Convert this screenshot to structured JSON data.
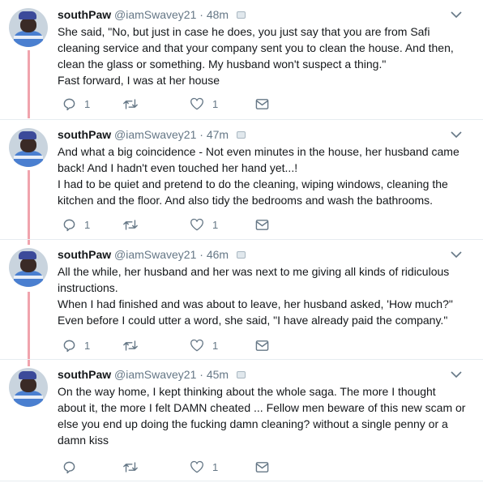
{
  "colors": {
    "thread_line": "#f0a4ad",
    "text": "#14171a",
    "secondary": "#657786",
    "divider": "#e6ecf0"
  },
  "icons": [
    "reply-icon",
    "retweet-icon",
    "heart-icon",
    "direct-message-icon",
    "chevron-down-icon",
    "media-badge-icon"
  ],
  "tweets": [
    {
      "name": "southPaw",
      "handle": "@iamSwavey21",
      "dot": "·",
      "time": "48m",
      "lines": [
        "She said, \"No, but just in case he does, you just say that you are from Safi",
        "cleaning service and that your company sent you to clean the house. And then,",
        "clean the glass or something. My husband won't suspect a thing.\"",
        "Fast forward, I was at her house"
      ],
      "replies": "1",
      "retweets": "",
      "likes": "1"
    },
    {
      "name": "southPaw",
      "handle": "@iamSwavey21",
      "dot": "·",
      "time": "47m",
      "lines": [
        "And what a big coincidence - Not even minutes in the house, her husband came",
        "back! And I hadn't even touched her hand yet...!",
        "I had to be quiet and pretend to do the cleaning, wiping windows, cleaning the",
        "kitchen and the floor. And also tidy the bedrooms and wash the bathrooms."
      ],
      "replies": "1",
      "retweets": "",
      "likes": "1"
    },
    {
      "name": "southPaw",
      "handle": "@iamSwavey21",
      "dot": "·",
      "time": "46m",
      "lines": [
        "All the while, her husband and her was next to me giving all kinds of ridiculous",
        "instructions.",
        "When I had finished and was about to leave, her husband asked, 'How much?\"",
        "Even before I could utter a word, she said, \"I have already paid the company.\""
      ],
      "replies": "1",
      "retweets": "",
      "likes": "1"
    },
    {
      "name": "southPaw",
      "handle": "@iamSwavey21",
      "dot": "·",
      "time": "45m",
      "lines": [
        "On the way home, I kept thinking about the whole saga. The more I thought",
        "about it, the more I felt DAMN cheated ... Fellow men beware of this new scam or",
        "else you end up doing the fucking damn cleaning? without a single penny or a",
        "damn kiss"
      ],
      "replies": "",
      "retweets": "",
      "likes": "1"
    }
  ]
}
